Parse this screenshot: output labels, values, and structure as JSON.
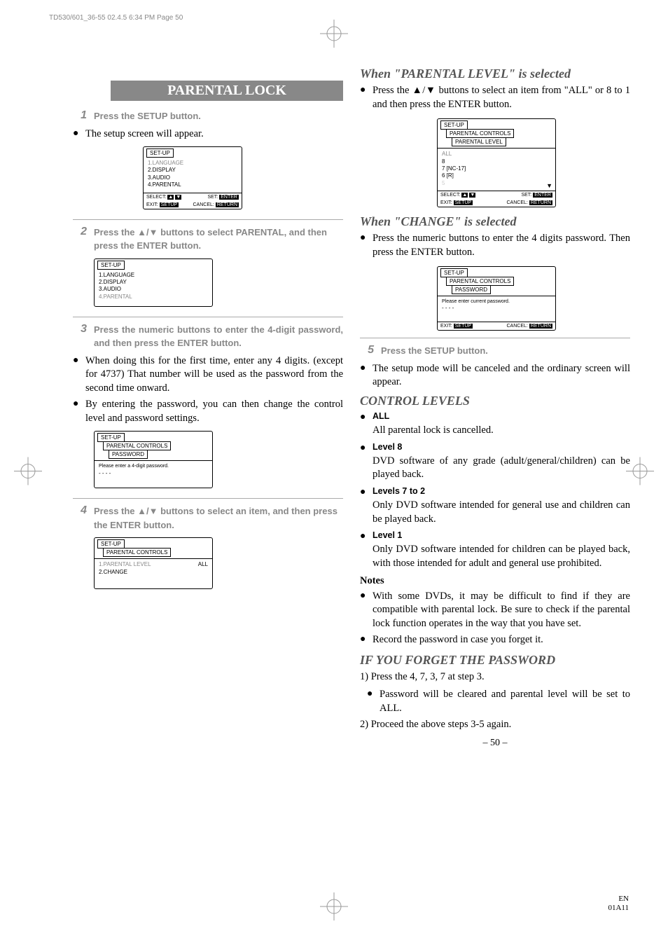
{
  "header_line": "TD530/601_36-55  02.4.5 6:34 PM  Page 50",
  "title": "PARENTAL LOCK",
  "left": {
    "step1": "Press the SETUP button.",
    "after1": "The setup screen will appear.",
    "osd1": {
      "tab1": "SET-UP",
      "items": [
        "1.LANGUAGE",
        "2.DISPLAY",
        "3.AUDIO",
        "4.PARENTAL"
      ],
      "footer": {
        "select": "SELECT:",
        "set": "SET:",
        "exit": "EXIT:",
        "cancel": "CANCEL:",
        "enter": "ENTER",
        "setup": "SETUP",
        "return": "RETURN"
      }
    },
    "step2": "Press the ▲/▼ buttons to select PARENTAL, and then press the ENTER button.",
    "osd2": {
      "tab1": "SET-UP",
      "items": [
        "1.LANGUAGE",
        "2.DISPLAY",
        "3.AUDIO",
        "4.PARENTAL"
      ]
    },
    "step3": "Press the numeric buttons to enter the 4-digit password, and then press the ENTER button.",
    "after3a": "When doing this for the first time, enter any 4 digits. (except for 4737) That number will be used as the password from the second time onward.",
    "after3b": "By entering the password, you can then change the control level and password settings.",
    "osd3": {
      "tab1": "SET-UP",
      "tab2": "PARENTAL CONTROLS",
      "tab3": "PASSWORD",
      "prompt": "Please enter a 4-digit password.",
      "dots": "- - - -"
    },
    "step4": "Press the ▲/▼ buttons to select an item, and then press the ENTER button.",
    "osd4": {
      "tab1": "SET-UP",
      "tab2": "PARENTAL CONTROLS",
      "item1": "1.PARENTAL LEVEL",
      "val1": "ALL",
      "item2": "2.CHANGE"
    }
  },
  "right": {
    "h1": "When \"PARENTAL LEVEL\" is selected",
    "p1": "Press the ▲/▼ buttons to select an item from \"ALL\" or 8 to 1 and then press the ENTER button.",
    "osd5": {
      "tab1": "SET-UP",
      "tab2": "PARENTAL CONTROLS",
      "tab3": "PARENTAL LEVEL",
      "items": [
        "ALL",
        "8",
        "7 [NC-17]",
        "6 [R]",
        "5"
      ],
      "footer": {
        "select": "SELECT:",
        "set": "SET:",
        "exit": "EXIT:",
        "cancel": "CANCEL:",
        "enter": "ENTER",
        "setup": "SETUP",
        "return": "RETURN"
      }
    },
    "h2": "When \"CHANGE\" is selected",
    "p2": "Press the numeric buttons to enter the 4 digits password. Then press the ENTER button.",
    "osd6": {
      "tab1": "SET-UP",
      "tab2": "PARENTAL CONTROLS",
      "tab3": "PASSWORD",
      "prompt": "Please enter current password.",
      "dots": "- - - -",
      "footer": {
        "exit": "EXIT:",
        "cancel": "CANCEL:",
        "setup": "SETUP",
        "return": "RETURN"
      }
    },
    "step5": "Press the SETUP button.",
    "after5": "The setup mode will be canceled and the ordinary screen will appear.",
    "h3": "CONTROL LEVELS",
    "lvl_all_h": "ALL",
    "lvl_all": "All parental lock is cancelled.",
    "lvl8_h": "Level 8",
    "lvl8": "DVD software of any grade (adult/general/children) can be played back.",
    "lvl72_h": "Levels 7 to 2",
    "lvl72": "Only DVD software intended for general use and children can be played back.",
    "lvl1_h": "Level 1",
    "lvl1": "Only DVD software intended for children can be played back, with those intended for adult and general use prohibited.",
    "notes_h": "Notes",
    "note1": "With some DVDs, it may be difficult to find if they are compatible with parental lock. Be sure to check if the parental lock function operates in the way that you have set.",
    "note2": "Record the password in case you forget it.",
    "h4": "IF YOU FORGET THE PASSWORD",
    "fp1": "1) Press the 4, 7, 3, 7 at step 3.",
    "fp_bullet": "Password will be cleared and parental level will be set to ALL.",
    "fp2": "2) Proceed the above steps 3-5 again."
  },
  "page_num": "– 50 –",
  "en": "EN",
  "code": "01A11"
}
